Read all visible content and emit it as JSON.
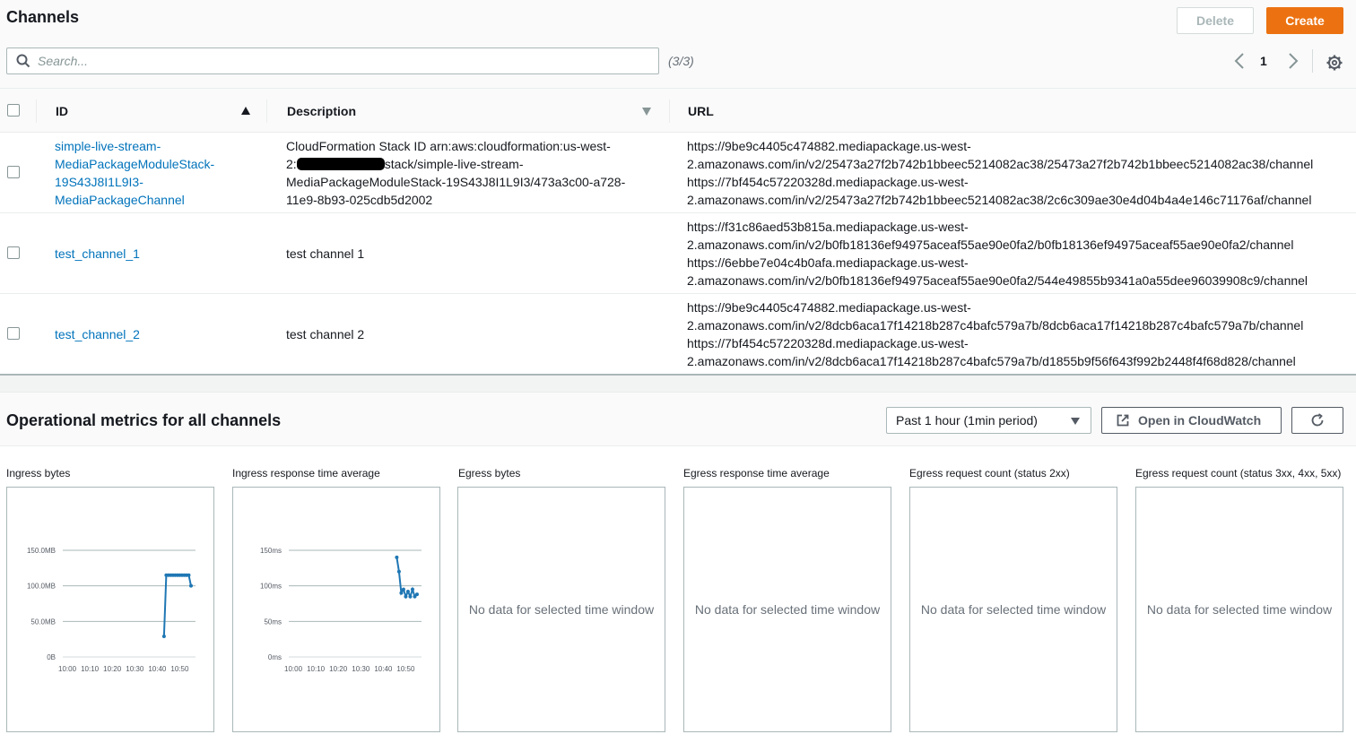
{
  "header": {
    "title": "Channels",
    "delete_label": "Delete",
    "create_label": "Create"
  },
  "search": {
    "placeholder": "Search...",
    "count": "(3/3)"
  },
  "pagination": {
    "page": "1"
  },
  "table": {
    "columns": {
      "id": "ID",
      "description": "Description",
      "url": "URL"
    },
    "rows": [
      {
        "id_lines": [
          "simple-live-stream-",
          "MediaPackageModuleStack-",
          "19S43J8I1L9I3-",
          "MediaPackageChannel"
        ],
        "desc_line1": "CloudFormation Stack ID arn:aws:cloudformation:us-west-",
        "desc_line2_prefix": "2:",
        "desc_line2_suffix": "stack/simple-live-stream-",
        "desc_line3": "MediaPackageModuleStack-19S43J8I1L9I3/473a3c00-a728-",
        "desc_line4": "11e9-8b93-025cdb5d2002",
        "url_lines": [
          "https://9be9c4405c474882.mediapackage.us-west-",
          "2.amazonaws.com/in/v2/25473a27f2b742b1bbeec5214082ac38/25473a27f2b742b1bbeec5214082ac38/channel",
          "https://7bf454c57220328d.mediapackage.us-west-",
          "2.amazonaws.com/in/v2/25473a27f2b742b1bbeec5214082ac38/2c6c309ae30e4d04b4a4e146c71176af/channel"
        ]
      },
      {
        "id": "test_channel_1",
        "description": "test channel 1",
        "url_lines": [
          "https://f31c86aed53b815a.mediapackage.us-west-",
          "2.amazonaws.com/in/v2/b0fb18136ef94975aceaf55ae90e0fa2/b0fb18136ef94975aceaf55ae90e0fa2/channel",
          "https://6ebbe7e04c4b0afa.mediapackage.us-west-",
          "2.amazonaws.com/in/v2/b0fb18136ef94975aceaf55ae90e0fa2/544e49855b9341a0a55dee96039908c9/channel"
        ]
      },
      {
        "id": "test_channel_2",
        "description": "test channel 2",
        "url_lines": [
          "https://9be9c4405c474882.mediapackage.us-west-",
          "2.amazonaws.com/in/v2/8dcb6aca17f14218b287c4bafc579a7b/8dcb6aca17f14218b287c4bafc579a7b/channel",
          "https://7bf454c57220328d.mediapackage.us-west-",
          "2.amazonaws.com/in/v2/8dcb6aca17f14218b287c4bafc579a7b/d1855b9f56f643f992b2448f4f68d828/channel"
        ]
      }
    ]
  },
  "metrics": {
    "title": "Operational metrics for all channels",
    "period": "Past 1 hour (1min period)",
    "cloudwatch_label": "Open in CloudWatch",
    "no_data": "No data for selected time window",
    "widgets": [
      "Ingress bytes",
      "Ingress response time average",
      "Egress bytes",
      "Egress response time average",
      "Egress request count (status 2xx)",
      "Egress request count (status 3xx, 4xx, 5xx)"
    ]
  },
  "colors": {
    "accent": "#ec7211",
    "link": "#0073bb",
    "series": "#1f77b4"
  },
  "chart_data": [
    {
      "type": "line",
      "title": "Ingress bytes",
      "xlabel": "",
      "ylabel": "",
      "x_ticks": [
        "10:00",
        "10:10",
        "10:20",
        "10:30",
        "10:40",
        "10:50"
      ],
      "y_ticks": [
        "0B",
        "50.0MB",
        "100.0MB",
        "150.0MB"
      ],
      "ylim": [
        0,
        150
      ],
      "grid": true,
      "series": [
        {
          "x": [
            "10:43",
            "10:44",
            "10:45",
            "10:46",
            "10:47",
            "10:48",
            "10:49",
            "10:50",
            "10:51",
            "10:52",
            "10:53",
            "10:54",
            "10:55"
          ],
          "values": [
            29,
            115,
            115,
            115,
            115,
            115,
            115,
            115,
            115,
            115,
            115,
            115,
            100
          ]
        }
      ]
    },
    {
      "type": "line",
      "title": "Ingress response time average",
      "xlabel": "",
      "ylabel": "",
      "x_ticks": [
        "10:00",
        "10:10",
        "10:20",
        "10:30",
        "10:40",
        "10:50"
      ],
      "y_ticks": [
        "0ms",
        "50ms",
        "100ms",
        "150ms"
      ],
      "ylim": [
        0,
        150
      ],
      "grid": true,
      "series": [
        {
          "x": [
            "10:46",
            "10:47",
            "10:48",
            "10:49",
            "10:50",
            "10:51",
            "10:52",
            "10:53",
            "10:54",
            "10:55"
          ],
          "values": [
            140,
            120,
            90,
            95,
            85,
            92,
            85,
            95,
            85,
            88
          ]
        }
      ]
    }
  ]
}
